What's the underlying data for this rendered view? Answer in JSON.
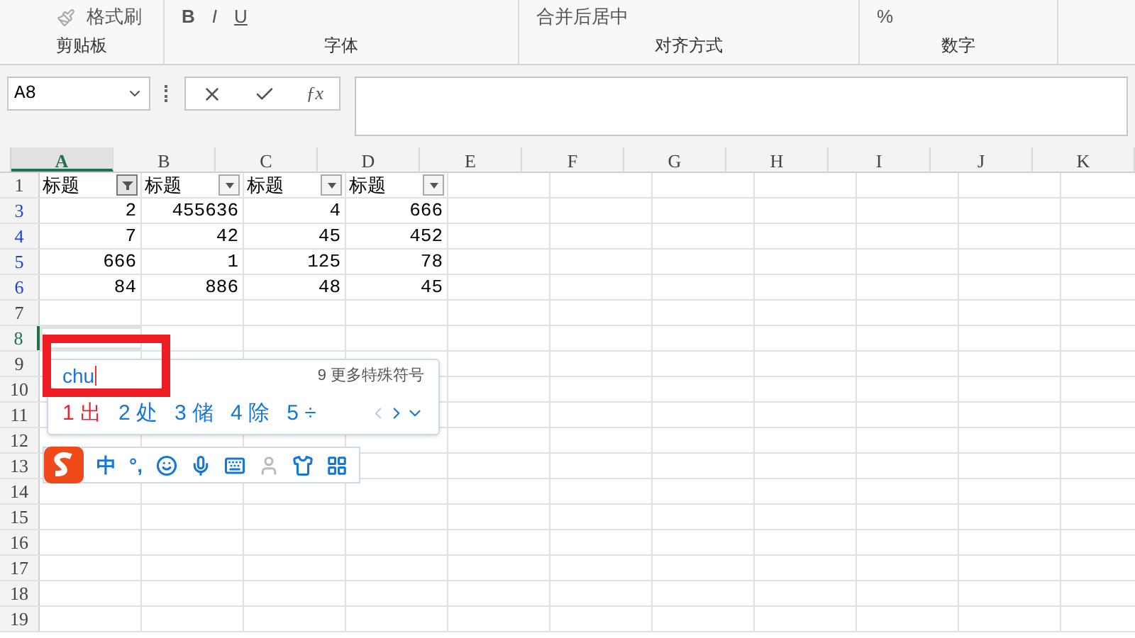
{
  "ribbon": {
    "groups": [
      {
        "label": "剪贴板",
        "items": [
          {
            "kind": "text",
            "text": "格式刷"
          }
        ]
      },
      {
        "label": "字体",
        "items": [
          {
            "kind": "bold",
            "text": "B"
          },
          {
            "kind": "italic",
            "text": "I"
          },
          {
            "kind": "underline",
            "text": "U"
          }
        ]
      },
      {
        "label": "对齐方式",
        "items": [
          {
            "kind": "text",
            "text": "合并后居中"
          }
        ]
      },
      {
        "label": "数字",
        "items": [
          {
            "kind": "text",
            "text": "%"
          }
        ]
      }
    ]
  },
  "formula_bar": {
    "name_box": "A8",
    "function_label": "ƒx"
  },
  "sheet": {
    "columns": [
      {
        "label": "A",
        "selected": true
      },
      {
        "label": "B",
        "selected": false
      },
      {
        "label": "C",
        "selected": false
      },
      {
        "label": "D",
        "selected": false
      },
      {
        "label": "E",
        "selected": false
      },
      {
        "label": "F",
        "selected": false
      },
      {
        "label": "G",
        "selected": false
      },
      {
        "label": "H",
        "selected": false
      },
      {
        "label": "I",
        "selected": false
      },
      {
        "label": "J",
        "selected": false
      },
      {
        "label": "K",
        "selected": false
      }
    ],
    "rows": [
      {
        "label": "1",
        "filtered": false,
        "selected": false,
        "cells": [
          "标题",
          "标题",
          "标题",
          "标题"
        ]
      },
      {
        "label": "3",
        "filtered": true,
        "selected": false,
        "cells": [
          "2",
          "455636",
          "4",
          "666"
        ]
      },
      {
        "label": "4",
        "filtered": true,
        "selected": false,
        "cells": [
          "7",
          "42",
          "45",
          "452"
        ]
      },
      {
        "label": "5",
        "filtered": true,
        "selected": false,
        "cells": [
          "666",
          "1",
          "125",
          "78"
        ]
      },
      {
        "label": "6",
        "filtered": true,
        "selected": false,
        "cells": [
          "84",
          "886",
          "48",
          "45"
        ]
      },
      {
        "label": "7",
        "filtered": false,
        "selected": false,
        "cells": []
      },
      {
        "label": "8",
        "filtered": false,
        "selected": true,
        "cells": []
      },
      {
        "label": "9",
        "filtered": false,
        "selected": false,
        "cells": []
      },
      {
        "label": "10",
        "filtered": false,
        "selected": false,
        "cells": []
      },
      {
        "label": "11",
        "filtered": false,
        "selected": false,
        "cells": []
      },
      {
        "label": "12",
        "filtered": false,
        "selected": false,
        "cells": []
      },
      {
        "label": "13",
        "filtered": false,
        "selected": false,
        "cells": []
      },
      {
        "label": "14",
        "filtered": false,
        "selected": false,
        "cells": []
      },
      {
        "label": "15",
        "filtered": false,
        "selected": false,
        "cells": []
      },
      {
        "label": "16",
        "filtered": false,
        "selected": false,
        "cells": []
      },
      {
        "label": "17",
        "filtered": false,
        "selected": false,
        "cells": []
      },
      {
        "label": "18",
        "filtered": false,
        "selected": false,
        "cells": []
      },
      {
        "label": "19",
        "filtered": false,
        "selected": false,
        "cells": []
      }
    ],
    "header_filters": [
      {
        "active": true
      },
      {
        "active": false
      },
      {
        "active": false
      },
      {
        "active": false
      }
    ]
  },
  "ime": {
    "input": "chu",
    "more": "9 更多特殊符号",
    "candidates": [
      {
        "num": "1",
        "text": "出",
        "selected": true
      },
      {
        "num": "2",
        "text": "处",
        "selected": false
      },
      {
        "num": "3",
        "text": "储",
        "selected": false
      },
      {
        "num": "4",
        "text": "除",
        "selected": false
      },
      {
        "num": "5",
        "text": "÷",
        "selected": false
      }
    ],
    "toolbar": [
      {
        "kind": "text",
        "text": "中"
      },
      {
        "kind": "text",
        "text": "°,"
      },
      {
        "kind": "emoji"
      },
      {
        "kind": "mic"
      },
      {
        "kind": "keyboard"
      },
      {
        "kind": "user"
      },
      {
        "kind": "shirt"
      },
      {
        "kind": "grid"
      }
    ]
  }
}
